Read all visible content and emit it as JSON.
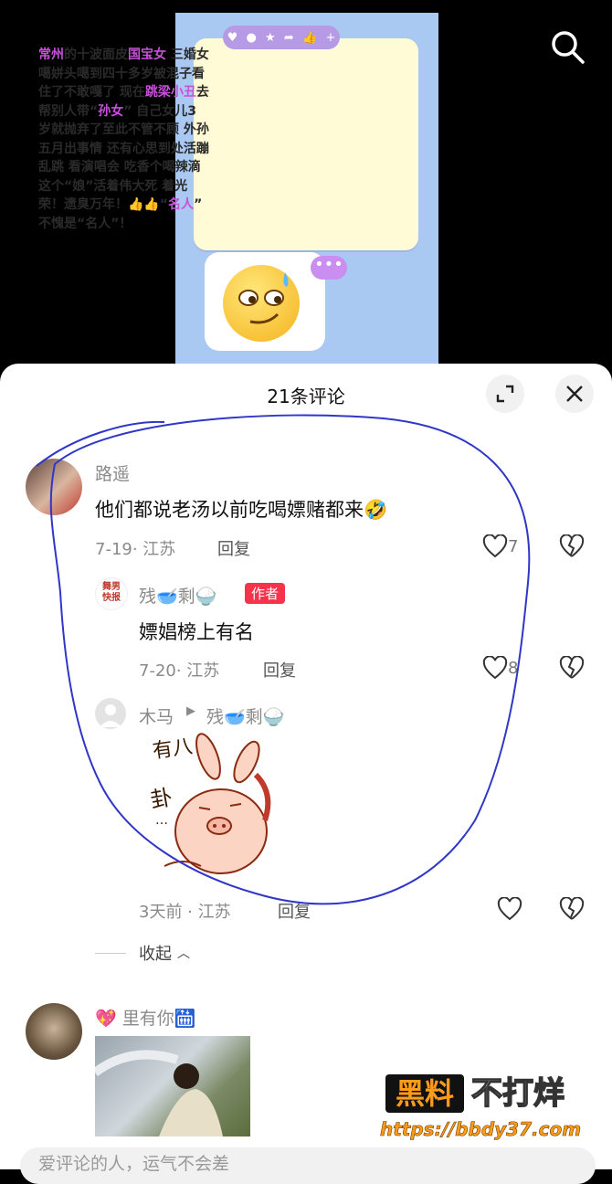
{
  "video": {
    "caption_parts": [
      {
        "t": "常州",
        "hl": true
      },
      {
        "t": "的十波面皮",
        "hl": false
      },
      {
        "t": "国宝女",
        "hl": true
      },
      {
        "t": " 三婚女\n噶姘头噶到四十多岁被混子看\n住了不敢嘎了 现在",
        "hl": false
      },
      {
        "t": "跳梁小丑",
        "hl": true
      },
      {
        "t": "去\n帮别人带“",
        "hl": false
      },
      {
        "t": "孙女",
        "hl": true
      },
      {
        "t": "” 自己女儿3\n岁就抛弃了至此不管不顾 外孙\n五月出事情 还有心思到处活蹦\n乱跳 看演唱会 吃香个喝辣滴\n这个“娘”活着伟大死 着光\n荣！遗臭万年！👍👍“",
        "hl": false
      },
      {
        "t": "名人",
        "hl": true
      },
      {
        "t": "”\n不愧是“名人”！",
        "hl": false
      }
    ],
    "icon_bar": [
      "♥",
      "●",
      "★",
      "➦",
      "👍",
      "+"
    ],
    "speech_dots": "•••"
  },
  "comments_header": {
    "title": "21条评论"
  },
  "comments": [
    {
      "name": "路遥",
      "content": "他们都说老汤以前吃喝嫖赌都来🤣",
      "meta": "7-19· 江苏",
      "reply_label": "回复",
      "likes": "7"
    }
  ],
  "replies": [
    {
      "name": "残🥣剩🍚",
      "badge": "作者",
      "content": "嫖娼榜上有名",
      "meta": "7-20· 江苏",
      "reply_label": "回复",
      "likes": "8",
      "avatar_text": "舞男\n快报"
    },
    {
      "name": "木马",
      "reply_to": "残🥣剩🍚",
      "sticker_text": "有八卦…",
      "meta": "3天前 · 江苏",
      "reply_label": "回复"
    }
  ],
  "collapse_label": "收起",
  "next_comment": {
    "name": "💖 里有你🛗"
  },
  "input": {
    "placeholder": "爱评论的人，运气不会差"
  },
  "watermark": {
    "black": "黑料",
    "white": "不打烊",
    "url": "https://bbdy37.com"
  },
  "colors": {
    "highlight": "#c652d8",
    "author_badge": "#f5334b",
    "annotation_ink": "#2f36c8"
  }
}
